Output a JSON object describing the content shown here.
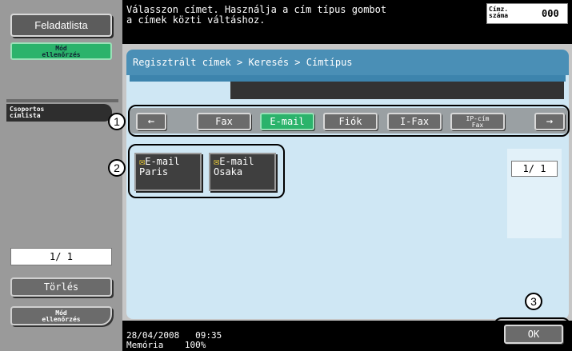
{
  "sidebar": {
    "job_list": "Feladatlista",
    "mode_check_top": "Mód\nellenőrzés",
    "group_list": "Csoportos\ncímlista",
    "page_counter": "1/ 1",
    "delete": "Törlés",
    "mode_check_bottom": "Mód\nellenőrzés"
  },
  "header": {
    "message": "Válasszon címet. Használja a cím típus gombot\na címek közti váltáshoz.",
    "count_label": "Címz.\nszáma",
    "count_value": "000"
  },
  "main": {
    "breadcrumb": "Regisztrált címek > Keresés > Címtípus",
    "tabs": [
      {
        "label": "Fax",
        "selected": false
      },
      {
        "label": "E-mail",
        "selected": true
      },
      {
        "label": "Fiók",
        "selected": false
      },
      {
        "label": "I-Fax",
        "selected": false
      },
      {
        "label": "IP-cím\nFax",
        "selected": false
      }
    ],
    "addresses": [
      {
        "type": "E-mail",
        "name": "Paris"
      },
      {
        "type": "E-mail",
        "name": "Osaka"
      }
    ],
    "page_indicator": "1/ 1",
    "ok": "OK"
  },
  "callouts": [
    "1",
    "2",
    "3"
  ],
  "footer": {
    "datetime": "28/04/2008   09:35",
    "memory": "Memória    100%"
  },
  "colors": {
    "accent": "#4a8fb6",
    "selected": "#2bb36b",
    "panel": "#cfe7f4"
  }
}
